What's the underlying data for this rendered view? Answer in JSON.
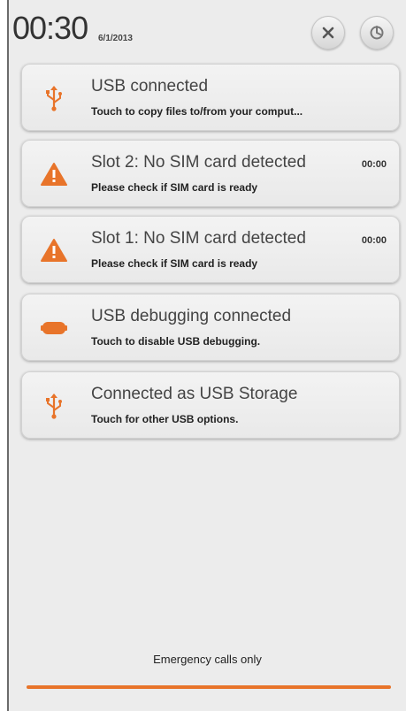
{
  "header": {
    "time": "00:30",
    "date": "6/1/2013",
    "close_icon": "close-icon",
    "settings_icon": "settings-icon"
  },
  "notifications": [
    {
      "icon": "usb-icon",
      "title": "USB connected",
      "subtitle": "Touch to copy files to/from your comput...",
      "time": ""
    },
    {
      "icon": "warning-icon",
      "title": "Slot 2: No SIM card detected",
      "subtitle": "Please check if SIM card is ready",
      "time": "00:00"
    },
    {
      "icon": "warning-icon",
      "title": "Slot 1: No SIM card detected",
      "subtitle": "Please check if SIM card is ready",
      "time": "00:00"
    },
    {
      "icon": "android-debug-icon",
      "title": "USB debugging connected",
      "subtitle": "Touch to disable USB debugging.",
      "time": ""
    },
    {
      "icon": "usb-icon",
      "title": "Connected as USB Storage",
      "subtitle": "Touch for other USB options.",
      "time": ""
    }
  ],
  "footer": {
    "status": "Emergency calls only"
  },
  "colors": {
    "accent": "#e8742a",
    "panel": "#ececec",
    "card": "#f0f0f0"
  }
}
